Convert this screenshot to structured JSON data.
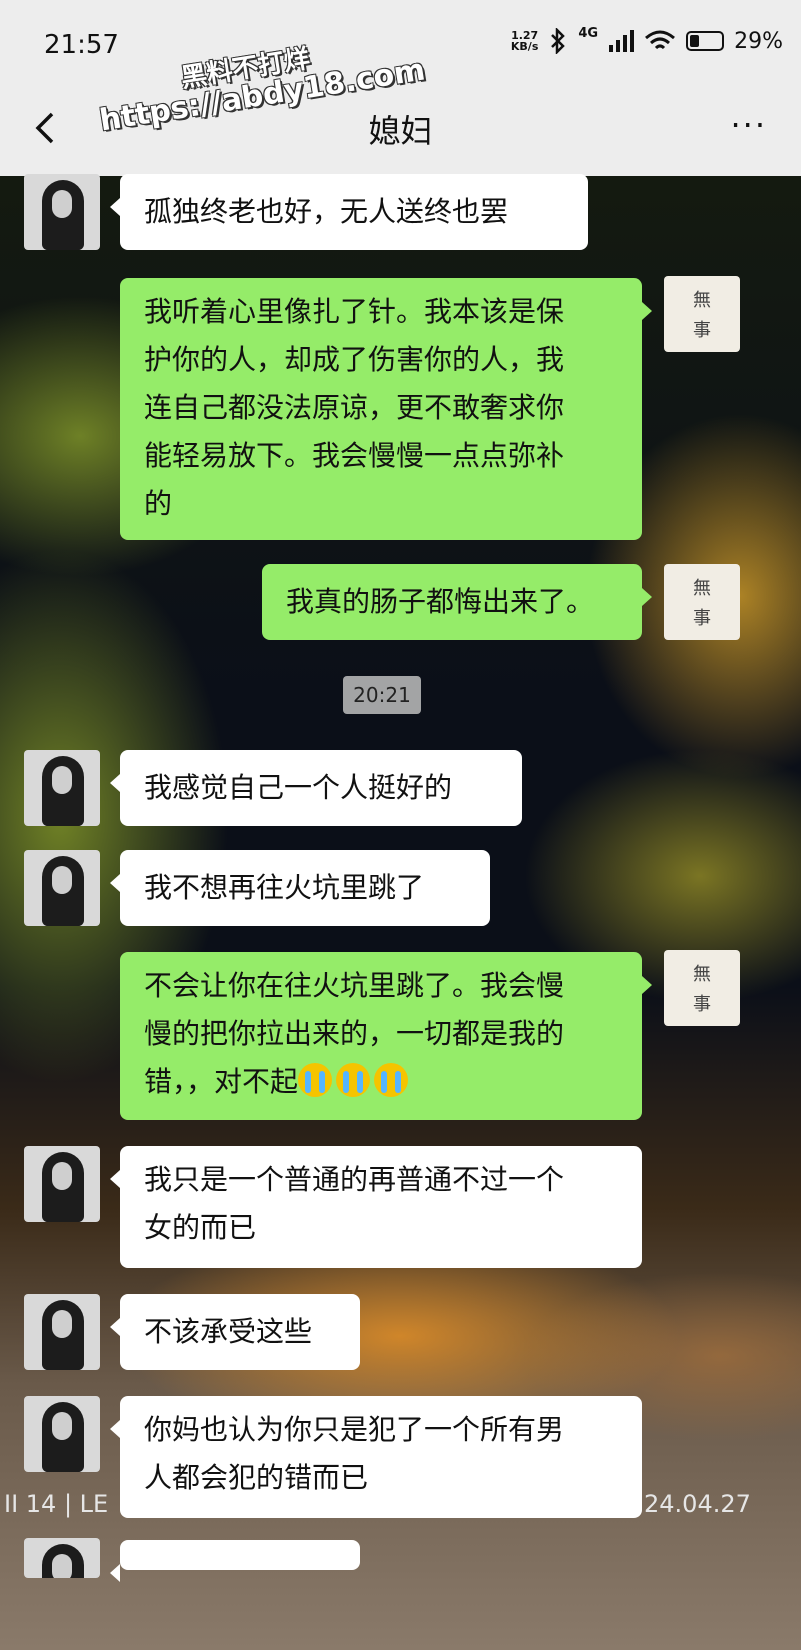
{
  "status_bar": {
    "time": "21:57",
    "net_speed_value": "1.27",
    "net_speed_unit": "KB/s",
    "network": "4G",
    "battery_percent": "29%",
    "battery_level": 0.29
  },
  "watermark": {
    "line1": "黑料不打烊",
    "line2": "https://abdy18.com"
  },
  "header": {
    "title": "媳妇",
    "more": "···"
  },
  "contact_avatar_char_top": "無",
  "contact_avatar_char_bottom": "事",
  "timestamp": "20:21",
  "messages": [
    {
      "side": "left",
      "text": "孤独终老也好，无人送终也罢"
    },
    {
      "side": "right",
      "lines": [
        "我听着心里像扎了针。我本该是保",
        "护你的人，却成了伤害你的人，我",
        "连自己都没法原谅，更不敢奢求你",
        "能轻易放下。我会慢慢一点点弥补",
        "的"
      ]
    },
    {
      "side": "right",
      "text": "我真的肠子都悔出来了。"
    },
    {
      "side": "left",
      "text": "我感觉自己一个人挺好的"
    },
    {
      "side": "left",
      "text": "我不想再往火坑里跳了"
    },
    {
      "side": "right",
      "lines": [
        "不会让你在往火坑里跳了。我会慢",
        "慢的把你拉出来的，一切都是我的",
        "错，，对不起"
      ],
      "emoji": "crying-face"
    },
    {
      "side": "left",
      "lines": [
        "我只是一个普通的再普通不过一个",
        "女的而已"
      ]
    },
    {
      "side": "left",
      "text": "不该承受这些"
    },
    {
      "side": "left",
      "lines": [
        "你妈也认为你只是犯了一个所有男",
        "人都会犯的错而已"
      ]
    }
  ],
  "photo_overlay": {
    "left": "II 14 | LE",
    "right": "24.04.27"
  }
}
